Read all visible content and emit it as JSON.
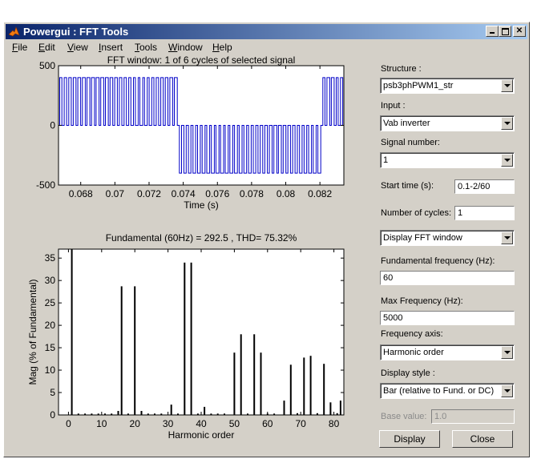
{
  "window": {
    "title": "Powergui : FFT Tools"
  },
  "menu": [
    {
      "label": "File",
      "key": "F",
      "rest": "ile"
    },
    {
      "label": "Edit",
      "key": "E",
      "rest": "dit"
    },
    {
      "label": "View",
      "key": "V",
      "rest": "iew"
    },
    {
      "label": "Insert",
      "key": "I",
      "rest": "nsert"
    },
    {
      "label": "Tools",
      "key": "T",
      "rest": "ools"
    },
    {
      "label": "Window",
      "key": "W",
      "rest": "indow"
    },
    {
      "label": "Help",
      "key": "H",
      "rest": "elp"
    }
  ],
  "panel": {
    "structure_label": "Structure :",
    "structure_value": "psb3phPWM1_str",
    "input_label": "Input :",
    "input_value": "Vab inverter",
    "signal_label": "Signal number:",
    "signal_value": "1",
    "start_label": "Start time (s):",
    "start_value": "0.1-2/60",
    "cycles_label": "Number of cycles:",
    "cycles_value": "1",
    "display_mode_value": "Display FFT window",
    "fund_label": "Fundamental frequency (Hz):",
    "fund_value": "60",
    "maxf_label": "Max Frequency (Hz):",
    "maxf_value": "5000",
    "freqaxis_label": "Frequency axis:",
    "freqaxis_value": "Harmonic order",
    "style_label": "Display style :",
    "style_value": "Bar (relative to Fund. or DC)",
    "base_label": "Base value:",
    "base_value": "1.0",
    "display_button": "Display",
    "close_button": "Close"
  },
  "colors": {
    "signal": "#0000c8",
    "bars": "#000000",
    "title_start": "#0a246a",
    "title_end": "#a6caf0"
  },
  "chart_data": [
    {
      "type": "line",
      "title": "FFT window: 1 of 6 cycles of selected signal",
      "xlabel": "Time (s)",
      "ylabel": "",
      "xlim": [
        0.0667,
        0.0834
      ],
      "ylim": [
        -500,
        500
      ],
      "yticks": [
        "500",
        "0",
        "-500"
      ],
      "ytick_values": [
        500,
        0,
        -500
      ],
      "xticks": [
        "0.068",
        "0.07",
        "0.072",
        "0.074",
        "0.076",
        "0.078",
        "0.08",
        "0.082"
      ],
      "xtick_values": [
        0.068,
        0.07,
        0.072,
        0.074,
        0.076,
        0.078,
        0.08,
        0.082
      ],
      "series": [
        {
          "amplitude": 400,
          "pulse_positive": [
            [
              0.0667,
              0.0737
            ],
            [
              0.0821,
              0.0834
            ]
          ],
          "pulse_negative": [
            [
              0.0737,
              0.0821
            ]
          ]
        }
      ]
    },
    {
      "type": "bar",
      "title": "Fundamental (60Hz) = 292.5 , THD= 75.32%",
      "xlabel": "Harmonic order",
      "ylabel": "Mag (% of Fundamental)",
      "xlim": [
        -3,
        83
      ],
      "ylim": [
        0,
        37
      ],
      "xticks": [
        "0",
        "10",
        "20",
        "30",
        "40",
        "50",
        "60",
        "70",
        "80"
      ],
      "xtick_values": [
        0,
        10,
        20,
        30,
        40,
        50,
        60,
        70,
        80
      ],
      "yticks": [
        "0",
        "5",
        "10",
        "15",
        "20",
        "25",
        "30",
        "35"
      ],
      "ytick_values": [
        0,
        5,
        10,
        15,
        20,
        25,
        30,
        35
      ],
      "x": [
        1,
        16,
        20,
        31,
        35,
        37,
        41,
        50,
        52,
        56,
        58,
        65,
        67,
        71,
        73,
        77,
        79,
        82,
        3,
        5,
        7,
        9,
        11,
        13,
        15,
        18,
        22,
        24,
        26,
        28,
        33,
        39,
        43,
        45,
        47,
        54,
        60,
        62,
        69,
        75,
        81
      ],
      "values": [
        100,
        28.7,
        28.7,
        2.3,
        34,
        34,
        1.8,
        13.9,
        18,
        18,
        13.9,
        3.2,
        11.2,
        12.8,
        13.2,
        11.4,
        2.8,
        3.2,
        0.3,
        0.3,
        0.3,
        0.3,
        0.3,
        0.3,
        0.9,
        0.3,
        0.9,
        0.3,
        0.3,
        0.3,
        0.3,
        0.3,
        0.3,
        0.3,
        0.3,
        0.3,
        0.3,
        0.3,
        0.4,
        0.4,
        0.4
      ]
    }
  ]
}
